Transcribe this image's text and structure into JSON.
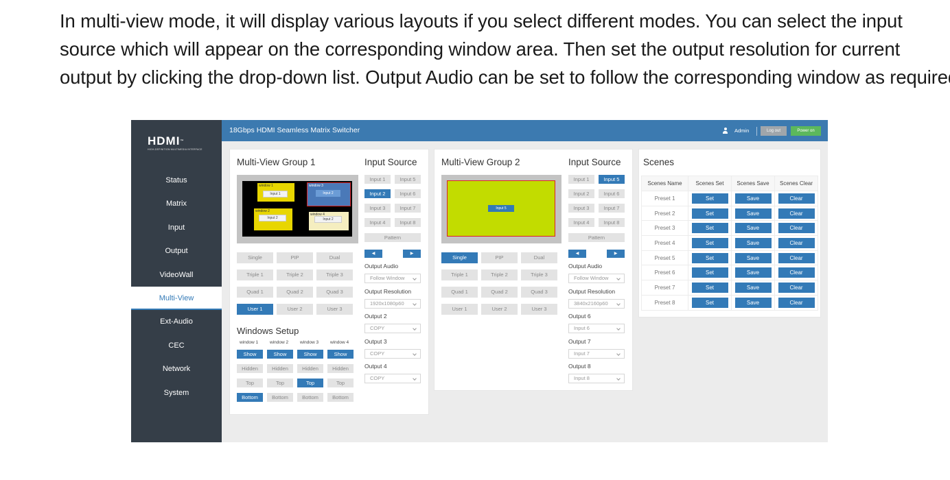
{
  "intro": [
    "In multi-view mode, it will display various layouts if you select different modes. You can select the input",
    "source which will appear on the corresponding window area. Then set the output resolution for current",
    "output by clicking the drop-down list. Output Audio can be set to follow the corresponding window as required."
  ],
  "logo": {
    "mark": "HDMI",
    "tm": "™",
    "sub": "HIGH-DEFINITION MULTIMEDIA INTERFACE"
  },
  "nav": [
    "Status",
    "Matrix",
    "Input",
    "Output",
    "VideoWall",
    "Multi-View",
    "Ext-Audio",
    "CEC",
    "Network",
    "System"
  ],
  "nav_active": "Multi-View",
  "topbar": {
    "title": "18Gbps HDMI Seamless Matrix Switcher",
    "user": "Admin",
    "logout": "Log out",
    "power": "Power on"
  },
  "group1": {
    "title": "Multi-View Group 1",
    "input_title": "Input Source",
    "windows": [
      {
        "label": "window 1",
        "input": "Input 1"
      },
      {
        "label": "window 2",
        "input": "Input 2"
      },
      {
        "label": "window 3",
        "input": "Input 2"
      },
      {
        "label": "window 4",
        "input": "Input 2"
      }
    ],
    "modes": [
      "Single",
      "PIP",
      "Dual",
      "Triple 1",
      "Triple 2",
      "Triple 3",
      "Quad 1",
      "Quad 2",
      "Quad 3",
      "User 1",
      "User 2",
      "User 3"
    ],
    "inputs": [
      "Input 1",
      "Input 5",
      "Input 2",
      "Input 6",
      "Input 3",
      "Input 7",
      "Input 4",
      "Input 8"
    ],
    "pattern": "Pattern",
    "output_audio_label": "Output Audio",
    "output_audio": "Follow Window",
    "output_resolution_label": "Output Resolution",
    "output_resolution": "1920x1080p60",
    "outputs": [
      {
        "label": "Output 2",
        "value": "COPY"
      },
      {
        "label": "Output 3",
        "value": "COPY"
      },
      {
        "label": "Output 4",
        "value": "COPY"
      }
    ],
    "windows_setup": {
      "title": "Windows Setup",
      "headers": [
        "window 1",
        "window 2",
        "window 3",
        "window 4"
      ],
      "show": "Show",
      "hidden": "Hidden",
      "top": "Top",
      "bottom": "Bottom"
    }
  },
  "group2": {
    "title": "Multi-View Group 2",
    "input_title": "Input Source",
    "window_input": "Input 5",
    "modes": [
      "Single",
      "PIP",
      "Dual",
      "Triple 1",
      "Triple 2",
      "Triple 3",
      "Quad 1",
      "Quad 2",
      "Quad 3",
      "User 1",
      "User 2",
      "User 3"
    ],
    "inputs": [
      "Input 1",
      "Input 5",
      "Input 2",
      "Input 6",
      "Input 3",
      "Input 7",
      "Input 4",
      "Input 8"
    ],
    "pattern": "Pattern",
    "output_audio_label": "Output Audio",
    "output_audio": "Follow Window",
    "output_resolution_label": "Output Resolution",
    "output_resolution": "3840x2160p60",
    "outputs": [
      {
        "label": "Output 6",
        "value": "Input 6"
      },
      {
        "label": "Output 7",
        "value": "Input 7"
      },
      {
        "label": "Output 8",
        "value": "Input 8"
      }
    ]
  },
  "scenes": {
    "title": "Scenes",
    "headers": [
      "Scenes Name",
      "Scenes Set",
      "Scenes Save",
      "Scenes Clear"
    ],
    "presets": [
      "Preset 1",
      "Preset 2",
      "Preset 3",
      "Preset 4",
      "Preset 5",
      "Preset 6",
      "Preset 7",
      "Preset 8"
    ],
    "set": "Set",
    "save": "Save",
    "clear": "Clear"
  },
  "colors": {
    "accent": "#337ab7",
    "sidebar": "#353e48",
    "topbar": "#3c7ab0",
    "power": "#5cb85c",
    "window": "#e8d600",
    "window_large": "#c2dc00"
  }
}
